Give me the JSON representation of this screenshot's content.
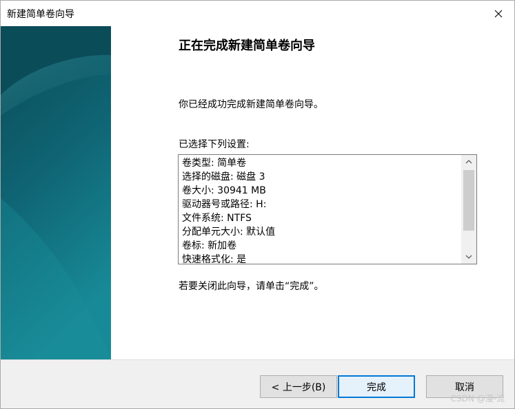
{
  "window": {
    "title": "新建简单卷向导"
  },
  "content": {
    "heading": "正在完成新建简单卷向导",
    "success_text": "你已经成功完成新建简单卷向导。",
    "settings_label": "已选择下列设置:",
    "settings": [
      "卷类型: 简单卷",
      "选择的磁盘: 磁盘 3",
      "卷大小: 30941 MB",
      "驱动器号或路径: H:",
      "文件系统: NTFS",
      "分配单元大小: 默认值",
      "卷标: 新加卷",
      "快速格式化: 是"
    ],
    "close_hint": "若要关闭此向导，请单击“完成”。"
  },
  "buttons": {
    "back": "< 上一步(B)",
    "finish": "完成",
    "cancel": "取消"
  },
  "watermark": "CSDN @漫-流",
  "colors": {
    "accent": "#0078d7",
    "banner_dark": "#0b4f5e",
    "banner_light": "#1a8a96"
  }
}
